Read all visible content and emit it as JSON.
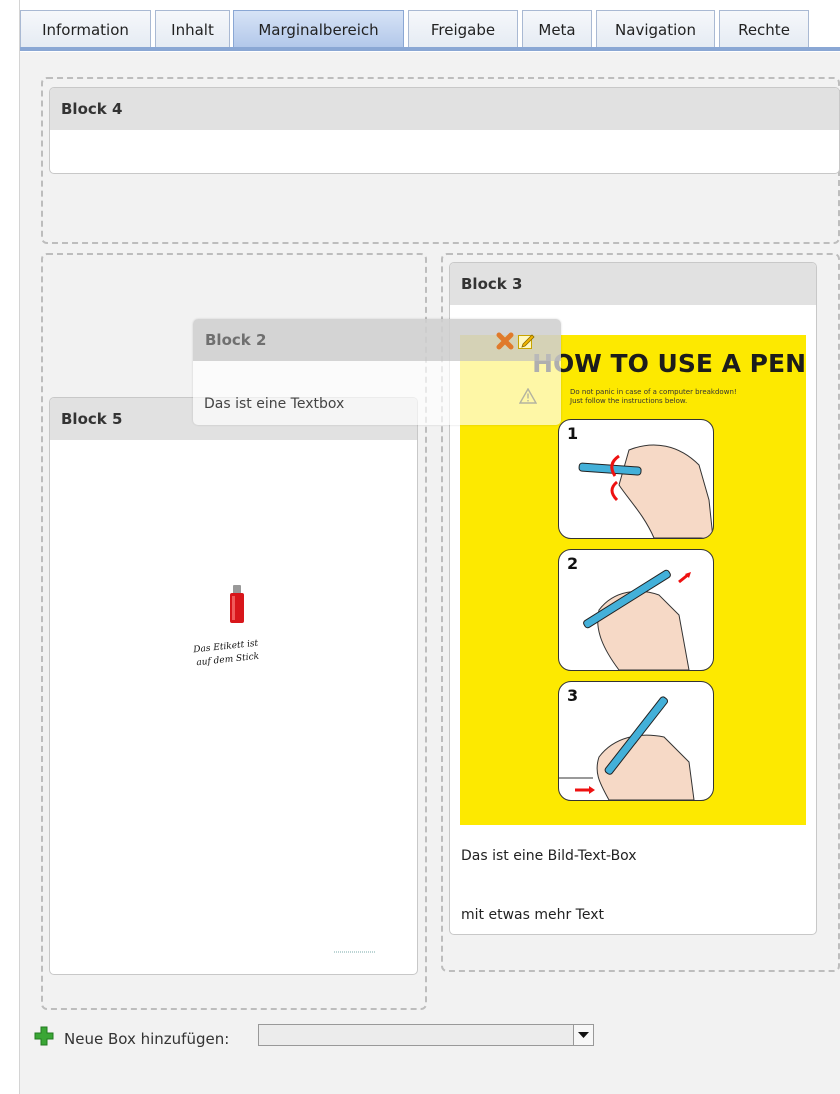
{
  "tabs": [
    {
      "label": "Information",
      "active": false
    },
    {
      "label": "Inhalt",
      "active": false
    },
    {
      "label": "Marginalbereich",
      "active": true
    },
    {
      "label": "Freigabe",
      "active": false
    },
    {
      "label": "Meta",
      "active": false
    },
    {
      "label": "Navigation",
      "active": false
    },
    {
      "label": "Rechte",
      "active": false
    }
  ],
  "blocks": {
    "block4": {
      "title": "Block 4"
    },
    "block2": {
      "title": "Block 2",
      "text": "Das ist eine Textbox",
      "icons": [
        "delete-icon",
        "edit-icon",
        "warning-icon"
      ]
    },
    "block5": {
      "title": "Block 5",
      "image_caption_line1": "Das Etikett ist",
      "image_caption_line2": "auf dem Stick"
    },
    "block3": {
      "title": "Block 3",
      "poster": {
        "title": "HOW TO USE A PEN",
        "subtitle": "Do not panic in case of a computer breakdown!\nJust follow the instructions below.",
        "steps": [
          "1",
          "2",
          "3"
        ]
      },
      "text1": "Das ist eine Bild-Text-Box",
      "text2": "mit etwas mehr Text"
    }
  },
  "add_box": {
    "label": "Neue Box hinzufügen:",
    "selected": ""
  },
  "colors": {
    "tab_accent": "#8aa7d4",
    "poster_yellow": "#fde900",
    "add_green": "#3aa635"
  }
}
